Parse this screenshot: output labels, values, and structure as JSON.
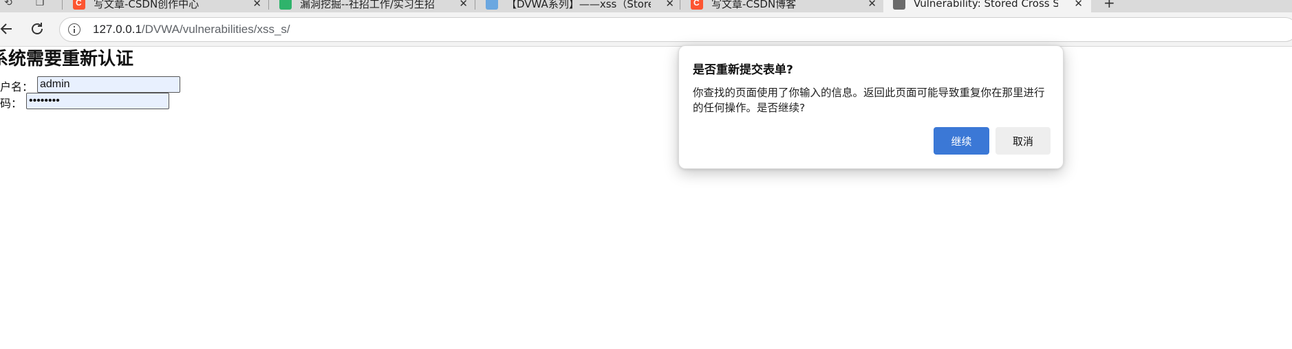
{
  "tabs": [
    {
      "title": "写文章-CSDN创作中心",
      "favicon": "csdn-icon"
    },
    {
      "title": "漏洞挖掘--社招工作/实习生招",
      "favicon": "green-circle-icon"
    },
    {
      "title": "【DVWA系列】——xss（Stored）",
      "favicon": "blue-doc-icon"
    },
    {
      "title": "写文章-CSDN博客",
      "favicon": "csdn-icon"
    },
    {
      "title": "Vulnerability: Stored Cross Site Sc",
      "favicon": "dvwa-icon"
    }
  ],
  "toolbar": {
    "url_host": "127.0.0.1",
    "url_path": "/DVWA/vulnerabilities/xss_s/"
  },
  "page": {
    "heading": "系统需要重新认证",
    "username_label": "用户名：",
    "username_value": "admin",
    "password_label": "密码：",
    "password_value": "password"
  },
  "dialog": {
    "title": "是否重新提交表单?",
    "message": "你查找的页面使用了你输入的信息。返回此页面可能导致重复你在那里进行的任何操作。是否继续?",
    "continue_label": "继续",
    "cancel_label": "取消"
  },
  "colors": {
    "primary_button": "#3b78d6",
    "csdn": "#fc5531"
  }
}
